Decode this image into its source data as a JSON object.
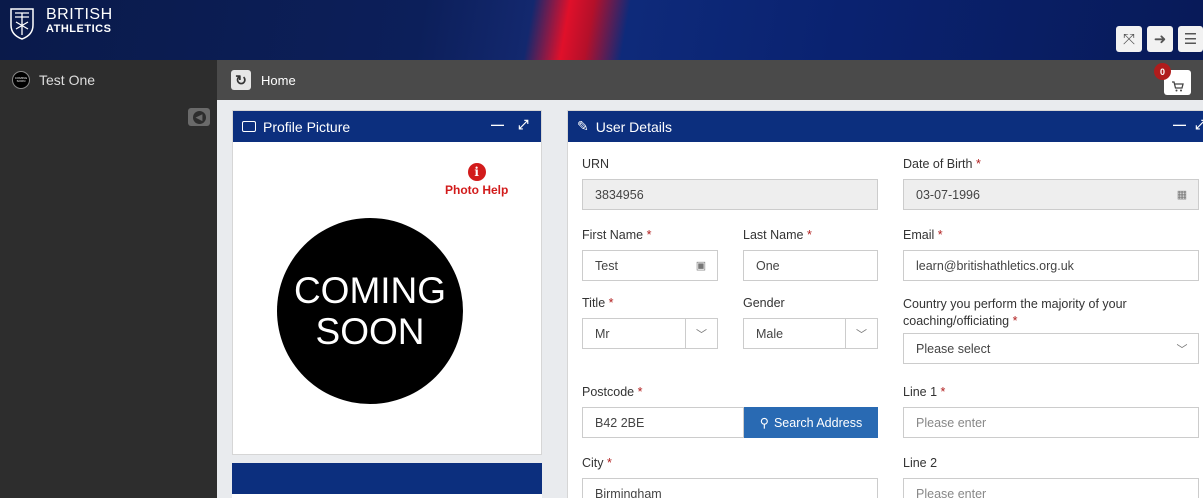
{
  "brand": {
    "line1": "BRITISH",
    "line2": "ATHLETICS"
  },
  "sidebar": {
    "user_name": "Test One",
    "avatar_text": "COMING SOON"
  },
  "breadcrumb": {
    "label": "Home"
  },
  "cart": {
    "count": "0"
  },
  "profile_panel": {
    "title": "Profile Picture",
    "help_label": "Photo Help",
    "placeholder_line1": "COMING",
    "placeholder_line2": "SOON"
  },
  "details_panel": {
    "title": "User Details",
    "urn": {
      "label": "URN",
      "value": "3834956"
    },
    "dob": {
      "label": "Date of Birth",
      "value": "03-07-1996"
    },
    "first_name": {
      "label": "First Name",
      "value": "Test"
    },
    "last_name": {
      "label": "Last Name",
      "value": "One"
    },
    "email": {
      "label": "Email",
      "value": "learn@britishathletics.org.uk"
    },
    "title_field": {
      "label": "Title",
      "value": "Mr"
    },
    "gender": {
      "label": "Gender",
      "value": "Male"
    },
    "country": {
      "label_line1": "Country you perform the majority of your",
      "label_line2": "coaching/officiating",
      "value": "Please select"
    },
    "postcode": {
      "label": "Postcode",
      "value": "B42 2BE"
    },
    "search_button": "Search Address",
    "line1": {
      "label": "Line 1",
      "placeholder": "Please enter"
    },
    "city": {
      "label": "City",
      "value": "Birmingham"
    },
    "line2": {
      "label": "Line 2",
      "placeholder": "Please enter"
    },
    "required_marker": "*"
  },
  "colors": {
    "header_blue": "#0c2f7e",
    "required_red": "#b01c1c",
    "button_blue": "#296ab3"
  }
}
